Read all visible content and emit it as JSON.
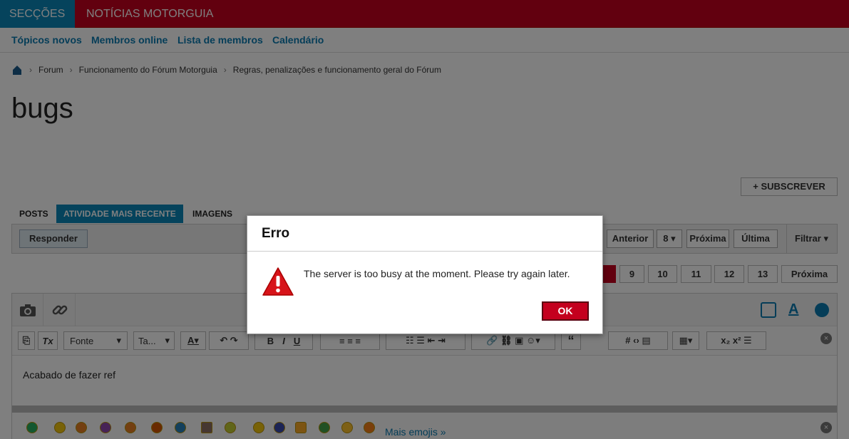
{
  "topbar": {
    "sections": "SECÇÕES",
    "news": "NOTÍCIAS MOTORGUIA"
  },
  "subnav": [
    "Tópicos novos",
    "Membros online",
    "Lista de membros",
    "Calendário"
  ],
  "breadcrumb": [
    "Forum",
    "Funcionamento do Fórum Motorguia",
    "Regras, penalizações e funcionamento geral do Fórum"
  ],
  "page_title": "bugs",
  "subscribe": "SUBSCREVER",
  "tabs": [
    "POSTS",
    "ATIVIDADE MAIS RECENTE",
    "IMAGENS"
  ],
  "toolbar": {
    "reply": "Responder",
    "prev": "Anterior",
    "page_select": "8",
    "next": "Próxima",
    "last": "Última",
    "filter": "Filtrar"
  },
  "pagination": {
    "pages": [
      "9",
      "10",
      "11",
      "12",
      "13"
    ],
    "next": "Próxima"
  },
  "editor": {
    "font_select": "Fonte",
    "size_select": "Ta...",
    "body": "Acabado de fazer ref",
    "more_emojis": "Mais emojis »"
  },
  "dialog": {
    "title": "Erro",
    "message": "The server is too busy at the moment. Please try again later.",
    "ok": "OK"
  },
  "colors": {
    "brand_red": "#c4001e",
    "brand_blue": "#0a86b8"
  }
}
